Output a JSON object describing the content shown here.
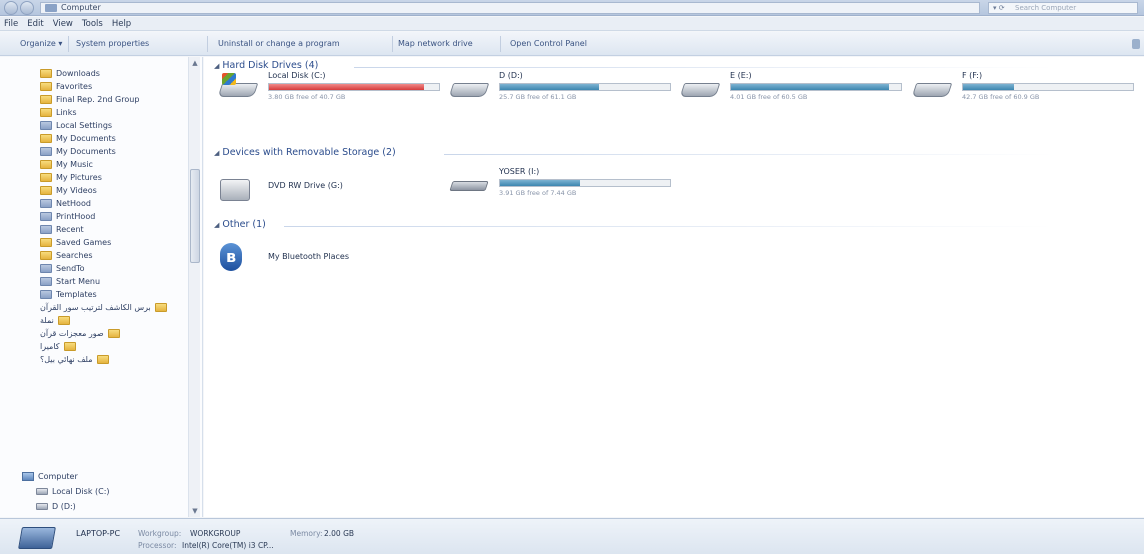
{
  "window": {
    "address": "Computer",
    "search_placeholder": "Search Computer"
  },
  "menu": [
    "File",
    "Edit",
    "View",
    "Tools",
    "Help"
  ],
  "toolbar": {
    "organize": "Organize ▾",
    "system_properties": "System properties",
    "uninstall": "Uninstall or change a program",
    "map_drive": "Map network drive",
    "control_panel": "Open Control Panel"
  },
  "sidebar": {
    "items": [
      {
        "label": "Downloads",
        "icon": "folder-icon"
      },
      {
        "label": "Favorites",
        "icon": "folder-icon"
      },
      {
        "label": "Final Rep. 2nd Group",
        "icon": "folder-icon"
      },
      {
        "label": "Links",
        "icon": "folder-icon"
      },
      {
        "label": "Local Settings",
        "icon": "folder-icon"
      },
      {
        "label": "My Documents",
        "icon": "folder-icon"
      },
      {
        "label": "My Documents",
        "icon": "folder-icon"
      },
      {
        "label": "My Music",
        "icon": "folder-icon"
      },
      {
        "label": "My Pictures",
        "icon": "folder-icon"
      },
      {
        "label": "My Videos",
        "icon": "folder-icon"
      },
      {
        "label": "NetHood",
        "icon": "folder-icon"
      },
      {
        "label": "PrintHood",
        "icon": "folder-icon"
      },
      {
        "label": "Recent",
        "icon": "folder-icon"
      },
      {
        "label": "Saved Games",
        "icon": "folder-icon"
      },
      {
        "label": "Searches",
        "icon": "folder-icon"
      },
      {
        "label": "SendTo",
        "icon": "folder-icon"
      },
      {
        "label": "Start Menu",
        "icon": "folder-icon"
      },
      {
        "label": "Templates",
        "icon": "folder-icon"
      },
      {
        "label": "برس الكاشف لترتيب سور القرآن",
        "icon": "folder-icon"
      },
      {
        "label": "نملة",
        "icon": "folder-icon"
      },
      {
        "label": "صور معجزات قرآن",
        "icon": "folder-icon"
      },
      {
        "label": "كاميرا",
        "icon": "folder-icon"
      },
      {
        "label": "ملف نهائي بيل؟",
        "icon": "folder-icon"
      }
    ],
    "computer_label": "Computer",
    "computer_children": [
      "Local Disk (C:)",
      "D (D:)"
    ]
  },
  "groups": {
    "hard_disks": "Hard Disk Drives (4)",
    "removable": "Devices with Removable Storage (2)",
    "other": "Other (1)"
  },
  "drives": [
    {
      "name": "Local Disk (C:)",
      "free": "3.80 GB free of 40.7 GB",
      "used_fraction": 0.91,
      "color": "#d63b3b"
    },
    {
      "name": "D (D:)",
      "free": "25.7 GB free of 61.1 GB",
      "used_fraction": 0.58,
      "color": "#3d86b0"
    },
    {
      "name": "E (E:)",
      "free": "4.01 GB free of 60.5 GB",
      "used_fraction": 0.93,
      "color": "#3d86b0"
    },
    {
      "name": "F (F:)",
      "free": "42.7 GB free of 60.9 GB",
      "used_fraction": 0.3,
      "color": "#3d86b0"
    }
  ],
  "removable": [
    {
      "name": "DVD RW Drive (G:)"
    },
    {
      "name": "YOSER (I:)",
      "free": "3.91 GB free of 7.44 GB",
      "used_fraction": 0.47
    }
  ],
  "other": [
    {
      "name": "My Bluetooth Places",
      "icon": "bluetooth-icon"
    }
  ],
  "details": {
    "name": "LAPTOP-PC",
    "workgroup_label": "Workgroup:",
    "workgroup": "WORKGROUP",
    "memory_label": "Memory:",
    "memory": "2.00 GB",
    "processor_label": "Processor:",
    "processor": "Intel(R) Core(TM) i3 CP..."
  }
}
